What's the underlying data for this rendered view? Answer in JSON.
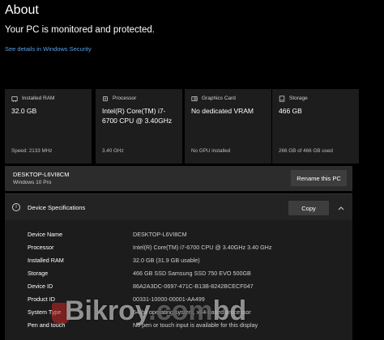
{
  "header": {
    "title": "About",
    "status": "Your PC is monitored and protected.",
    "security_link": "See details in Windows Security"
  },
  "cards": [
    {
      "icon": "ram-chip-icon",
      "label": "Installed RAM",
      "value": "32.0 GB",
      "sub": "Speed: 2133 MHz"
    },
    {
      "icon": "processor-icon",
      "label": "Processor",
      "value": "Intel(R) Core(TM) i7-6700 CPU @ 3.40GHz",
      "sub": "3.40 GHz"
    },
    {
      "icon": "graphics-card-icon",
      "label": "Graphics Card",
      "value": "No dedicated VRAM",
      "sub": "No GPU installed"
    },
    {
      "icon": "storage-icon",
      "label": "Storage",
      "value": "466 GB",
      "sub": "266 GB of 466 GB used"
    }
  ],
  "device": {
    "name": "DESKTOP-L6VI8CM",
    "edition": "Windows 10 Pro",
    "rename_label": "Rename this PC"
  },
  "specs": {
    "title": "Device Specifications",
    "copy_label": "Copy",
    "rows": [
      {
        "key": "Device Name",
        "value": "DESKTOP-L6VI8CM"
      },
      {
        "key": "Processor",
        "value": "Intel(R) Core(TM) i7-6700 CPU @ 3.40GHz   3.40 GHz"
      },
      {
        "key": "Installed RAM",
        "value": "32.0 GB (31.9 GB usable)"
      },
      {
        "key": "Storage",
        "value": "466 GB SSD Samsung SSD 750 EVO 500GB"
      },
      {
        "key": "Device ID",
        "value": "86A2A3DC-0697-471C-B13B-8242BCECF047"
      },
      {
        "key": "Product ID",
        "value": "00331-10000-00001-AA499"
      },
      {
        "key": "System Type",
        "value": "64-bit operating system, x64-based processor"
      },
      {
        "key": "Pen and touch",
        "value": "No pen or touch input is available for this display"
      }
    ]
  },
  "watermark": {
    "text": "Bikroy",
    "suffix": ".com",
    "tld": "bd"
  }
}
